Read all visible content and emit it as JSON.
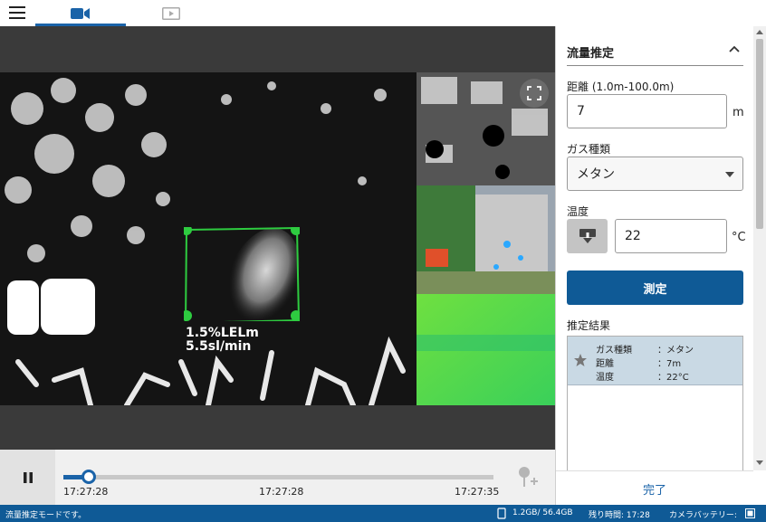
{
  "tabs": [
    {
      "icon": "video-camera-icon",
      "active": true
    },
    {
      "icon": "play-video-icon",
      "active": false
    }
  ],
  "overlay": {
    "concentration": "1.5%LELm",
    "flow": "5.5sl/min"
  },
  "player": {
    "time_start": "17:27:28",
    "time_mid": "17:27:28",
    "time_end": "17:27:35",
    "progress_fraction": 0.058,
    "state": "playing"
  },
  "panel": {
    "title": "流量推定",
    "distance_label": "距離 (1.0m-100.0m)",
    "distance_value": "7",
    "distance_unit": "m",
    "gas_label": "ガス種類",
    "gas_value": "メタン",
    "temp_label": "温度",
    "temp_value": "22",
    "temp_unit": "°C",
    "measure_button": "測定",
    "results_label": "推定結果",
    "result": {
      "gas_key": "ガス種類",
      "gas_val": "：メタン",
      "dist_key": "距離",
      "dist_val": "：7m",
      "temp_key": "温度",
      "temp_val": "：22°C"
    },
    "done_button": "完了"
  },
  "status": {
    "mode": "流量推定モードです。",
    "storage": "1.2GB/ 56.4GB",
    "remaining": "残り時間: 17:28",
    "battery": "カメラバッテリー:"
  },
  "colors": {
    "accent": "#1a63a8",
    "roi": "#2ecc40",
    "status_bg": "#0f5a96"
  }
}
